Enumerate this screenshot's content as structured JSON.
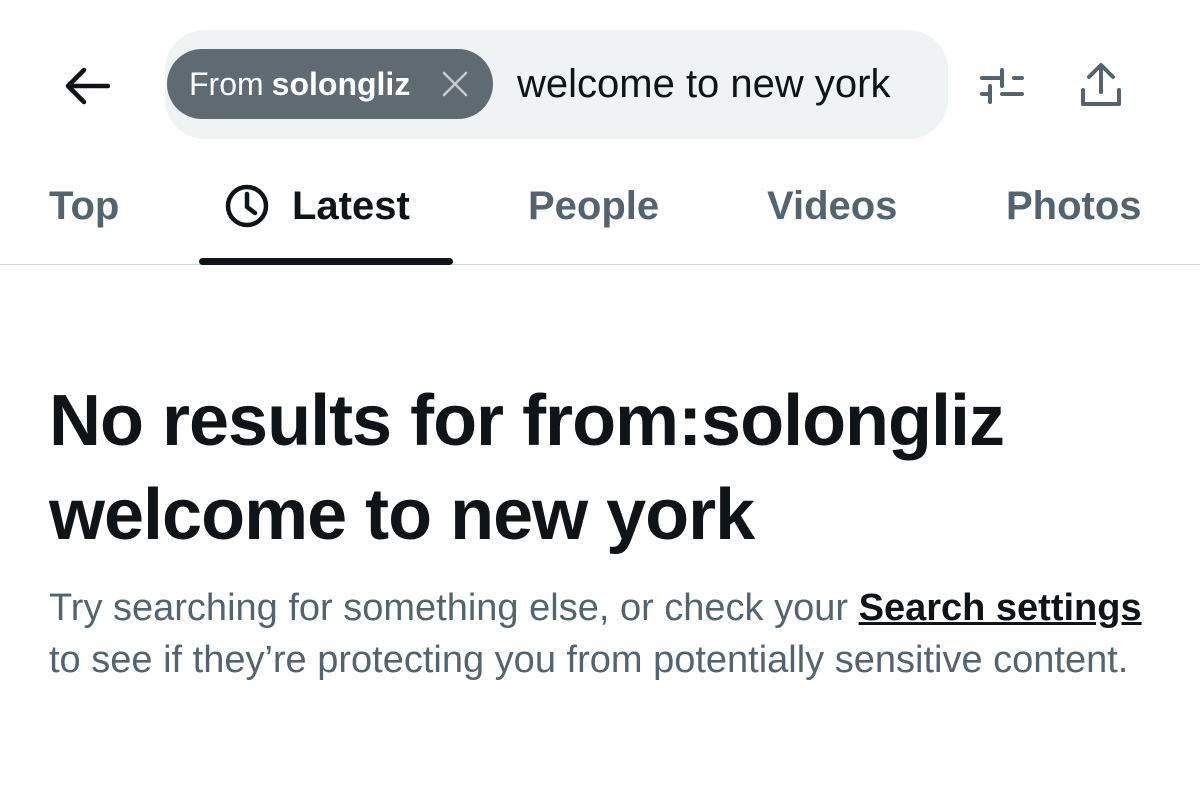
{
  "header": {
    "back_icon": "arrow-left-icon",
    "search": {
      "chip_prefix": "From",
      "chip_user": "solongliz",
      "chip_close_icon": "close-icon",
      "query": "welcome to new york"
    },
    "filter_icon": "sliders-icon",
    "share_icon": "share-icon"
  },
  "tabs": [
    {
      "label": "Top",
      "active": false
    },
    {
      "label": "Latest",
      "active": true,
      "icon": "clock-icon"
    },
    {
      "label": "People",
      "active": false
    },
    {
      "label": "Videos",
      "active": false
    },
    {
      "label": "Photos",
      "active": false
    }
  ],
  "empty_state": {
    "title": "No results for from:solongliz welcome to new york",
    "desc_before": "Try searching for something else, or check your ",
    "desc_link": "Search settings",
    "desc_after": " to see if they’re protecting you from potentially sensitive content."
  },
  "colors": {
    "text_primary": "#0f1419",
    "text_secondary": "#536471",
    "search_bg": "#eff3f4",
    "chip_bg": "#5f6a73",
    "divider": "#cfd9de"
  }
}
